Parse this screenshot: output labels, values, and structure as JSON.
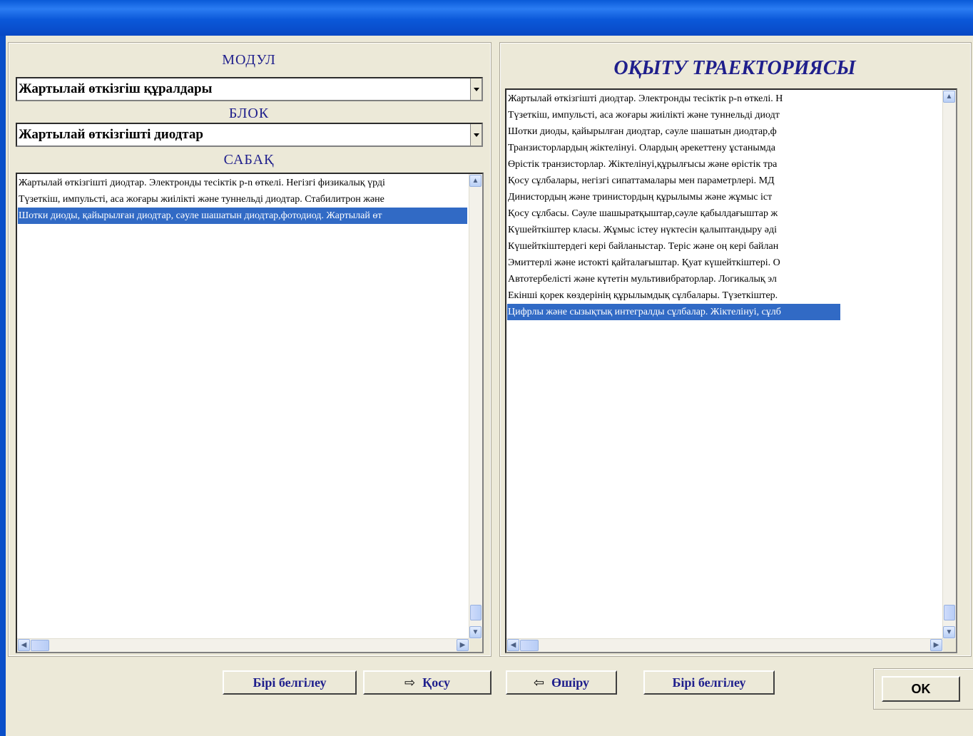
{
  "colors": {
    "title_bar": "#0a5ad8",
    "heading": "#1f1f8c",
    "selection": "#316ac5",
    "face": "#ece9d8"
  },
  "left": {
    "modul_heading": "МОДУЛ",
    "modul_value": "Жартылай өткізгіш құралдары",
    "block_heading": "БЛОК",
    "block_value": "Жартылай өткізгішті диодтар",
    "lesson_heading": "САБАҚ",
    "lessons": [
      "Жартылай өткізгішті диодтар. Электронды  тесіктік p-n өткелі. Негізгі физикалық үрді",
      "Түзеткіш, импульсті, аса жоғары жиілікті және туннельді диодтар. Стабилитрон және",
      "Шотки диоды, қайырылған диодтар, сәуле шашатын диодтар,фотодиод. Жартылай өт"
    ],
    "selected_index": 2
  },
  "right": {
    "heading": "ОҚЫТУ ТРАЕКТОРИЯСЫ",
    "items": [
      "Жартылай өткізгішті диодтар. Электронды  тесіктік p-n өткелі. Н",
      "Түзеткіш, импульсті, аса жоғары жиілікті және туннельді диодт",
      "Шотки диоды, қайырылған диодтар, сәуле шашатын диодтар,ф",
      "Транзисторлардың жіктелінуі. Олардың әрекеттену ұстанымда",
      "Өрістік транзисторлар. Жіктелінуі,құрылғысы және өрістік тра",
      "Қосу сұлбалары, негізгі сипаттамалары мен параметрлері.  МД",
      "Динистордың және тринистордың құрылымы және жұмыс іст",
      "Қосу сұлбасы. Сәуле шашыратқыштар,сәуле қабылдағыштар ж",
      "Күшейткіштер класы. Жұмыс істеу нүктесін қалыптандыру әді",
      "Күшейткіштердегі кері байланыстар. Теріс және оң кері байлан",
      "Эмиттерлі және истокті қайталағыштар. Қуат күшейткіштері. О",
      "Автотербелісті және күтетін мультивибраторлар. Логикалық эл",
      "Екінші қорек көздерінің құрылымдық сұлбалары. Түзеткіштер.",
      "Цифрлы және сызықтық интегралды сұлбалар. Жіктелінуі, сұлб"
    ],
    "selected_index": 13
  },
  "buttons": {
    "select_all_left": "Бірі белгілеу",
    "add": "Қосу",
    "remove": "Өшіру",
    "select_all_right": "Бірі белгілеу",
    "ok": "OK"
  },
  "icons": {
    "add": "arrow-right-icon",
    "remove": "arrow-left-icon",
    "dropdown": "chevron-down-icon"
  }
}
